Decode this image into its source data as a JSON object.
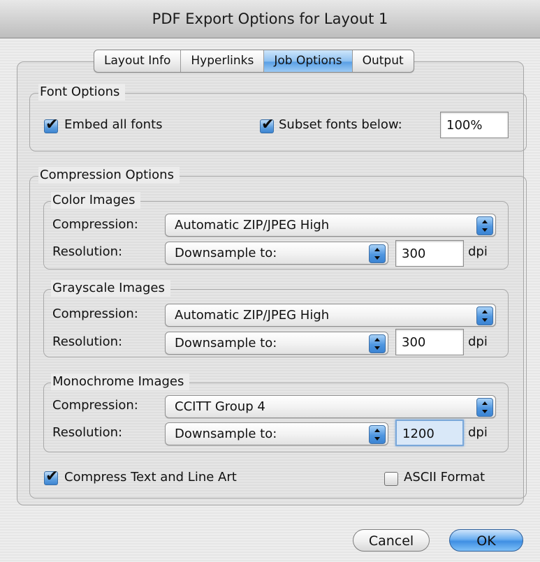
{
  "window": {
    "title": "PDF Export Options for Layout 1"
  },
  "tabs": [
    "Layout Info",
    "Hyperlinks",
    "Job Options",
    "Output"
  ],
  "active_tab": "Job Options",
  "font_options": {
    "legend": "Font Options",
    "embed_all_fonts": {
      "label": "Embed all fonts",
      "checked": true
    },
    "subset_fonts": {
      "label": "Subset fonts below:",
      "checked": true,
      "value": "100%"
    }
  },
  "compression_options": {
    "legend": "Compression Options",
    "color": {
      "legend": "Color Images",
      "compression_label": "Compression:",
      "compression_value": "Automatic ZIP/JPEG High",
      "resolution_label": "Resolution:",
      "resolution_mode": "Downsample to:",
      "dpi_value": "300",
      "dpi_unit": "dpi"
    },
    "grayscale": {
      "legend": "Grayscale Images",
      "compression_label": "Compression:",
      "compression_value": "Automatic ZIP/JPEG High",
      "resolution_label": "Resolution:",
      "resolution_mode": "Downsample to:",
      "dpi_value": "300",
      "dpi_unit": "dpi"
    },
    "monochrome": {
      "legend": "Monochrome Images",
      "compression_label": "Compression:",
      "compression_value": "CCITT Group 4",
      "resolution_label": "Resolution:",
      "resolution_mode": "Downsample to:",
      "dpi_value": "1200",
      "dpi_unit": "dpi"
    },
    "compress_text": {
      "label": "Compress Text and Line Art",
      "checked": true
    },
    "ascii_format": {
      "label": "ASCII Format",
      "checked": false
    }
  },
  "buttons": {
    "cancel": "Cancel",
    "ok": "OK"
  },
  "colors": {
    "accent": "#4f96e0",
    "title_bar": "#d0d0d0"
  }
}
